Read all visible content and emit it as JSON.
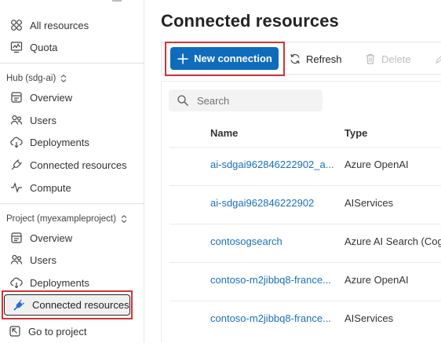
{
  "sidebar": {
    "top_items": [
      {
        "label": "All resources",
        "icon": "grid-icon"
      },
      {
        "label": "Quota",
        "icon": "quota-icon"
      }
    ],
    "hub": {
      "label": "Hub (sdg-ai)",
      "items": [
        {
          "label": "Overview",
          "icon": "overview-icon"
        },
        {
          "label": "Users",
          "icon": "users-icon"
        },
        {
          "label": "Deployments",
          "icon": "deployments-icon"
        },
        {
          "label": "Connected resources",
          "icon": "plug-icon"
        },
        {
          "label": "Compute",
          "icon": "compute-icon"
        }
      ]
    },
    "project": {
      "label": "Project (myexampleproject)",
      "items": [
        {
          "label": "Overview",
          "icon": "overview-icon"
        },
        {
          "label": "Users",
          "icon": "users-icon"
        },
        {
          "label": "Deployments",
          "icon": "deployments-icon"
        },
        {
          "label": "Connected resources",
          "icon": "plug-icon",
          "selected": true
        }
      ]
    },
    "go_to_project": {
      "label": "Go to project",
      "icon": "go-to-icon"
    }
  },
  "main": {
    "title": "Connected resources",
    "toolbar": {
      "new_connection": "New connection",
      "refresh": "Refresh",
      "delete": "Delete"
    },
    "search": {
      "placeholder": "Search"
    },
    "table": {
      "columns": [
        "Name",
        "Type"
      ],
      "rows": [
        {
          "name": "ai-sdgai962846222902_a...",
          "type": "Azure OpenAI"
        },
        {
          "name": "ai-sdgai962846222902",
          "type": "AIServices"
        },
        {
          "name": "contosogsearch",
          "type": "Azure AI Search (Cogn"
        },
        {
          "name": "contoso-m2jibbq8-france...",
          "type": "Azure OpenAI"
        },
        {
          "name": "contoso-m2jibbq8-france...",
          "type": "AIServices"
        }
      ]
    }
  },
  "colors": {
    "accent": "#0f6cbd",
    "highlight": "#d13438",
    "link": "#1a6fbd"
  }
}
